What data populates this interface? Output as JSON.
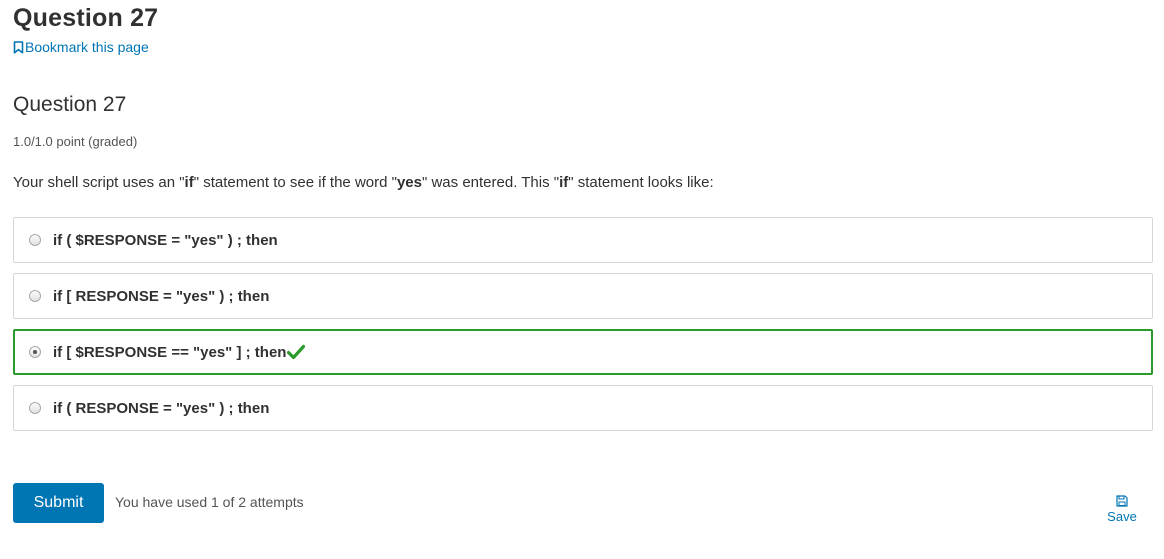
{
  "page": {
    "title": "Question 27",
    "bookmark_label": "Bookmark this page"
  },
  "problem": {
    "title": "Question 27",
    "points": "1.0/1.0 point (graded)",
    "prompt": {
      "p1": "Your shell script uses an \"",
      "b1": "if",
      "p2": "\" statement to see if the word \"",
      "b2": "yes",
      "p3": "\" was entered. This \"",
      "b3": "if",
      "p4": "\" statement looks like:"
    },
    "choices": [
      {
        "label": "if ( $RESPONSE = \"yes\" ) ; then",
        "selected": false,
        "correct": false
      },
      {
        "label": "if [ RESPONSE = \"yes\" ) ; then",
        "selected": false,
        "correct": false
      },
      {
        "label": "if [ $RESPONSE == \"yes\" ] ; then",
        "selected": true,
        "correct": true
      },
      {
        "label": "if ( RESPONSE = \"yes\" ) ; then",
        "selected": false,
        "correct": false
      }
    ]
  },
  "actions": {
    "submit_label": "Submit",
    "attempts_text": "You have used 1 of 2 attempts",
    "save_label": "Save"
  },
  "colors": {
    "accent": "#0075b4",
    "correct": "#2a9b2a",
    "border": "#d7d7d7"
  },
  "icons": {
    "bookmark": "bookmark-icon",
    "check": "checkmark-icon",
    "save": "floppy-disk-icon"
  }
}
